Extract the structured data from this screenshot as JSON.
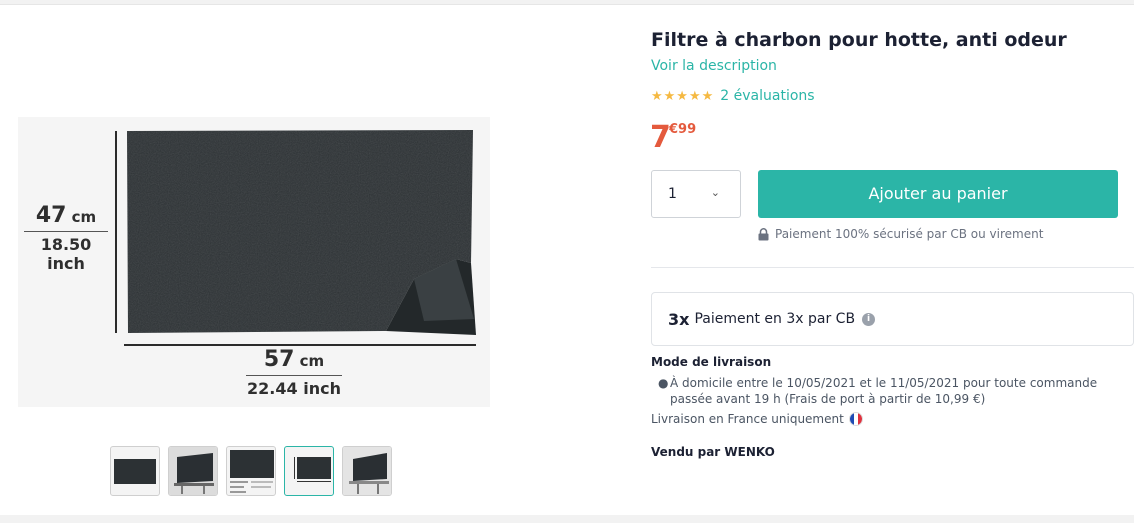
{
  "product": {
    "title": "Filtre à charbon pour hotte, anti odeur",
    "description_link": "Voir la description",
    "rating_stars": 5,
    "rating_count_label": "2 évaluations",
    "price_integer": "7",
    "price_decimal": "€99"
  },
  "image": {
    "height_cm": "47",
    "height_unit": "cm",
    "height_inch": "18.50 inch",
    "width_cm": "57",
    "width_unit": "cm",
    "width_inch": "22.44 inch",
    "thumbnail_count": 5,
    "active_thumbnail_index": 3
  },
  "purchase": {
    "quantity": "1",
    "add_to_cart": "Ajouter au panier",
    "secure_payment": "Paiement 100% sécurisé par CB ou virement"
  },
  "installment": {
    "badge": "3x",
    "label": "Paiement en 3x par CB",
    "info_icon": "i"
  },
  "shipping": {
    "title": "Mode de livraison",
    "items": [
      "À domicile entre le 10/05/2021 et le 11/05/2021 pour toute commande passée avant 19 h (Frais de port à partir de 10,99 €)"
    ],
    "note": "Livraison en France uniquement"
  },
  "seller": "Vendu par WENKO",
  "colors": {
    "accent": "#2bb5a7",
    "price": "#e45a3d",
    "stars": "#f5b942",
    "text": "#1c2133"
  }
}
